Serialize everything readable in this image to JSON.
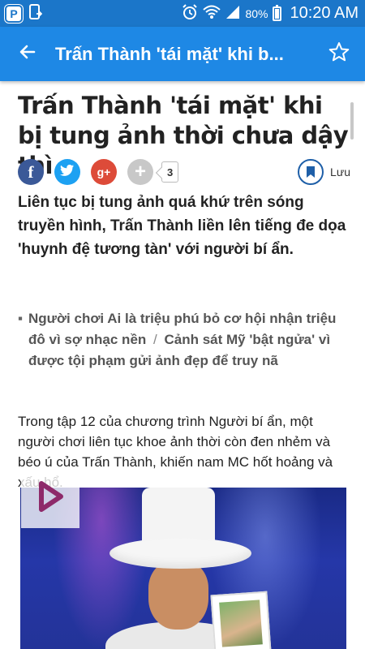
{
  "status_bar": {
    "app_icon_letter": "P",
    "battery_percent": "80%",
    "time": "10:20 AM"
  },
  "app_bar": {
    "title": "Trấn Thành 'tái mặt' khi b..."
  },
  "article": {
    "headline": "Trấn Thành 'tái mặt' khi bị tung ảnh thời chưa dậy thì",
    "share": {
      "facebook_label": "f",
      "twitter_label": "t",
      "google_label": "g+",
      "plus_label": "+",
      "share_count": "3",
      "save_label": "Lưu"
    },
    "lead": "Liên tục bị tung ảnh quá khứ trên sóng truyền hình, Trấn Thành liền lên tiếng đe dọa 'huynh đệ tương tàn' với người bí ẩn.",
    "related": [
      "Người chơi Ai là triệu phú bỏ cơ hội nhận triệu đô vì sợ nhạc nền",
      "Cảnh sát Mỹ 'bật ngửa' vì được tội phạm gửi ảnh đẹp để truy nã"
    ],
    "related_separator": "/",
    "body_paragraph": "Trong tập 12 của chương trình Người bí ẩn, một người chơi liên tục khoe ảnh thời còn đen nhẻm và béo ú của Trấn Thành, khiến nam MC hốt hoảng và xấu hổ."
  },
  "colors": {
    "status_bar": "#1b76c9",
    "app_bar": "#1e88e5",
    "facebook": "#3b5998",
    "twitter": "#1da1f2",
    "google": "#dd4b39",
    "play_accent": "#8e2a6a"
  },
  "icons": {
    "back": "arrow-left-icon",
    "favorite": "star-outline-icon",
    "save": "bookmark-icon",
    "play": "play-icon"
  }
}
